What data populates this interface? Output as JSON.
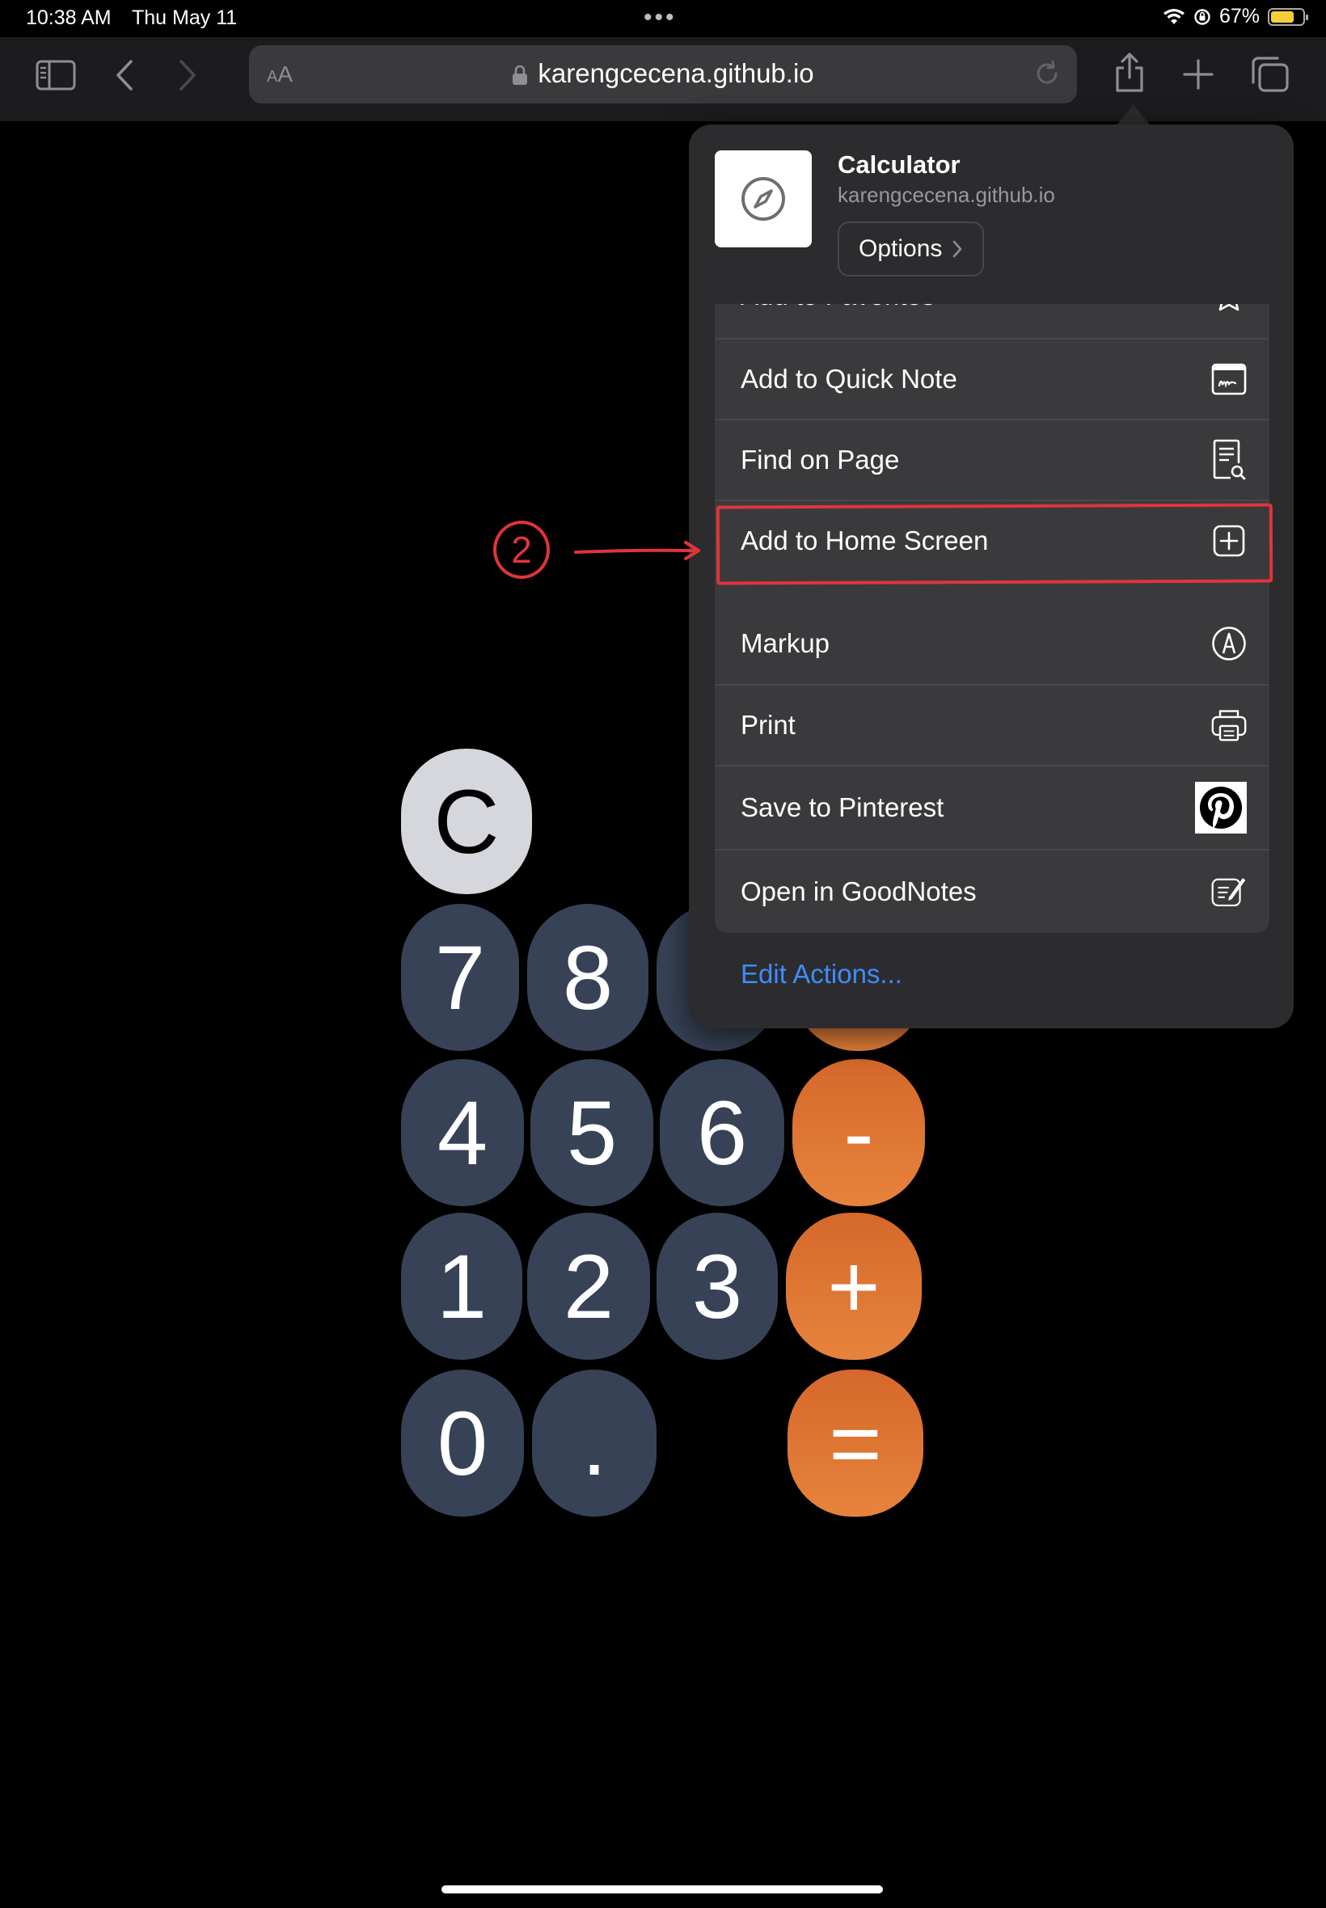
{
  "status_bar": {
    "time": "10:38 AM",
    "date": "Thu May 11",
    "multitasking_dots": "•••",
    "battery_percent": "67%",
    "battery_level": 0.67
  },
  "toolbar": {
    "reader_label_small": "A",
    "reader_label_large": "A",
    "url_host": "karengcecena.github.io"
  },
  "calculator": {
    "clear": "C",
    "keys": {
      "seven": "7",
      "eight": "8",
      "four": "4",
      "five": "5",
      "six": "6",
      "minus": "-",
      "one": "1",
      "two": "2",
      "three": "3",
      "plus": "+",
      "zero": "0",
      "decimal": ".",
      "equals": "="
    }
  },
  "share_sheet": {
    "title": "Calculator",
    "subtitle": "karengcecena.github.io",
    "options_label": "Options",
    "partial_row_label": "Add to Favorites",
    "group1": [
      {
        "label": "Add to Quick Note",
        "icon": "quick-note-icon"
      },
      {
        "label": "Find on Page",
        "icon": "find-on-page-icon"
      },
      {
        "label": "Add to Home Screen",
        "icon": "add-square-icon"
      }
    ],
    "group2": [
      {
        "label": "Markup",
        "icon": "markup-icon"
      },
      {
        "label": "Print",
        "icon": "printer-icon"
      },
      {
        "label": "Save to Pinterest",
        "icon": "pinterest-icon"
      },
      {
        "label": "Open in GoodNotes",
        "icon": "goodnotes-icon"
      }
    ],
    "edit_actions": "Edit Actions..."
  },
  "annotation": {
    "step_number": "2",
    "color": "#e0343a"
  },
  "colors": {
    "accent_blue": "#3f8cff",
    "calc_number": "#374256",
    "calc_operator": "#e37b35",
    "calc_clear": "#d5d7dc"
  }
}
